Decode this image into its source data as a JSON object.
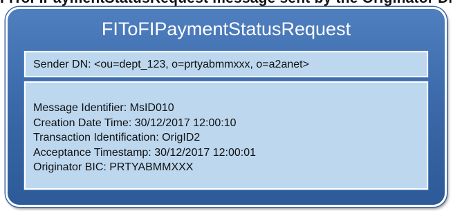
{
  "header_text": "FIToFIPaymentStatusRequest message sent by the Originator DN participant",
  "message": {
    "title": "FIToFIPaymentStatusRequest",
    "sender_dn": "Sender DN: <ou=dept_123, o=prtyabmmxxx, o=a2anet>",
    "fields": [
      "Message Identifier: MsID010",
      "Creation Date Time: 30/12/2017 12:00:10",
      "Transaction Identification: OrigID2",
      "Acceptance Timestamp: 30/12/2017 12:00:01",
      "Originator BIC: PRTYABMMXXX"
    ]
  },
  "colors": {
    "box_fill": "#3a68a8",
    "panel_fill": "#bcd7ee",
    "border": "#ffffff",
    "title_text": "#ffffff"
  }
}
